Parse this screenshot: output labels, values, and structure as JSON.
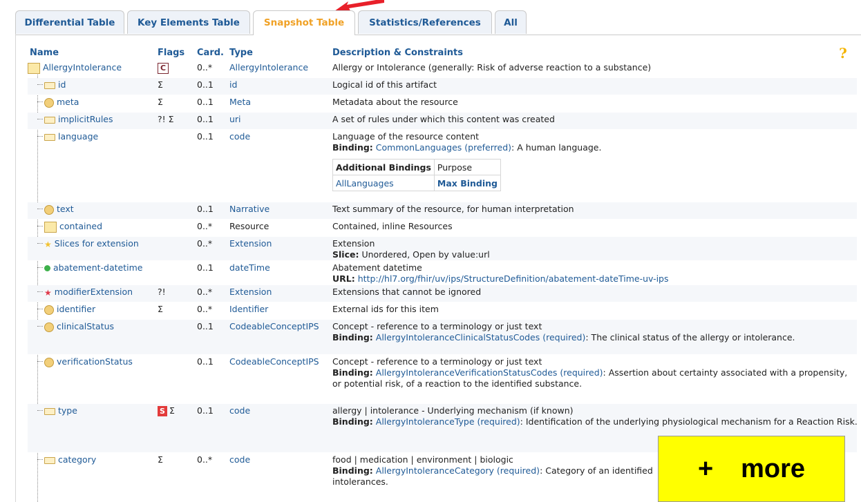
{
  "tabs": [
    "Differential Table",
    "Key Elements Table",
    "Snapshot Table",
    "Statistics/References",
    "All"
  ],
  "active_tab": "Snapshot Table",
  "columns": {
    "name": "Name",
    "flags": "Flags",
    "card": "Card.",
    "type": "Type",
    "desc": "Description & Constraints"
  },
  "help_icon": "?",
  "rows": [
    {
      "name": "AllergyIntolerance",
      "flags": "C",
      "card": "0..*",
      "type": "AllergyIntolerance",
      "desc": "Allergy or Intolerance (generally: Risk of adverse reaction to a substance)"
    },
    {
      "name": "id",
      "flags": "Σ",
      "card": "0..1",
      "type": "id",
      "desc": "Logical id of this artifact"
    },
    {
      "name": "meta",
      "flags": "Σ",
      "card": "0..1",
      "type": "Meta",
      "desc": "Metadata about the resource"
    },
    {
      "name": "implicitRules",
      "flags": "?! Σ",
      "card": "0..1",
      "type": "uri",
      "desc": "A set of rules under which this content was created"
    },
    {
      "name": "language",
      "flags": "",
      "card": "0..1",
      "type": "code",
      "desc": "Language of the resource content",
      "binding_label": "Binding:",
      "binding_link": "CommonLanguages",
      "binding_strength": "(preferred)",
      "binding_text": ": A human language.",
      "additional_bindings": {
        "header": "Additional Bindings",
        "purpose": "Purpose",
        "value": "AllLanguages",
        "purpose_value": "Max Binding"
      }
    },
    {
      "name": "text",
      "flags": "",
      "card": "0..1",
      "type": "Narrative",
      "desc": "Text summary of the resource, for human interpretation"
    },
    {
      "name": "contained",
      "flags": "",
      "card": "0..*",
      "type": "Resource",
      "desc": "Contained, inline Resources"
    },
    {
      "name": "Slices for extension",
      "flags": "",
      "card": "0..*",
      "type": "Extension",
      "desc": "Extension",
      "extra_label": "Slice:",
      "extra_text": " Unordered, Open by value:url"
    },
    {
      "name": "abatement-datetime",
      "flags": "",
      "card": "0..1",
      "type": "dateTime",
      "desc": "Abatement datetime",
      "extra_label": "URL:",
      "extra_link": "http://hl7.org/fhir/uv/ips/StructureDefinition/abatement-dateTime-uv-ips"
    },
    {
      "name": "modifierExtension",
      "flags": "?!",
      "card": "0..*",
      "type": "Extension",
      "desc": "Extensions that cannot be ignored"
    },
    {
      "name": "identifier",
      "flags": "Σ",
      "card": "0..*",
      "type": "Identifier",
      "desc": "External ids for this item"
    },
    {
      "name": "clinicalStatus",
      "flags": "",
      "card": "0..1",
      "type": "CodeableConceptIPS",
      "desc": "Concept - reference to a terminology or just text",
      "binding_label": "Binding:",
      "binding_link": "AllergyIntoleranceClinicalStatusCodes",
      "binding_strength": "(required)",
      "binding_text": ": The clinical status of the allergy or intolerance."
    },
    {
      "name": "verificationStatus",
      "flags": "",
      "card": "0..1",
      "type": "CodeableConceptIPS",
      "desc": "Concept - reference to a terminology or just text",
      "binding_label": "Binding:",
      "binding_link": "AllergyIntoleranceVerificationStatusCodes",
      "binding_strength": "(required)",
      "binding_text": ": Assertion about certainty associated with a propensity, or potential risk, of a reaction to the identified substance."
    },
    {
      "name": "type",
      "flags_s": "S",
      "flags": "Σ",
      "card": "0..1",
      "type": "code",
      "desc": "allergy | intolerance - Underlying mechanism (if known)",
      "binding_label": "Binding:",
      "binding_link": "AllergyIntoleranceType",
      "binding_strength": "(required)",
      "binding_text": ": Identification of the underlying physiological mechanism for a Reaction Risk."
    },
    {
      "name": "category",
      "flags": "Σ",
      "card": "0..*",
      "type": "code",
      "desc": "food | medication | environment | biologic",
      "binding_label": "Binding:",
      "binding_link": "AllergyIntoleranceCategory",
      "binding_strength": "(required)",
      "binding_text": ": Category of an identified",
      "binding_text2": "intolerances."
    }
  ],
  "overlay": {
    "plus": "+",
    "label": "more"
  },
  "colors": {
    "link": "#1f5a96",
    "active_tab": "#f0a125",
    "overlay": "#ffff00",
    "arrow": "#e8202a"
  }
}
